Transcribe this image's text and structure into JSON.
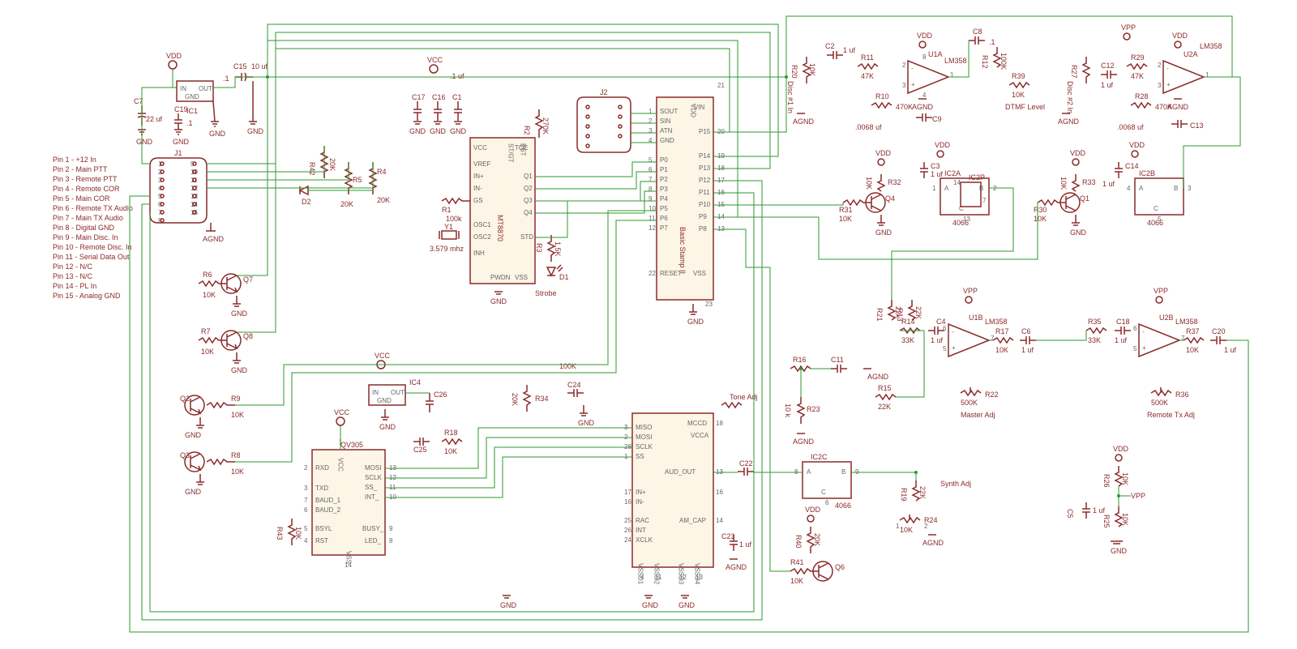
{
  "pinout": {
    "title": "",
    "pins": [
      "Pin 1 - +12 In",
      "Pin 2 - Main PTT",
      "Pin 3 - Remote PTT",
      "Pin 4 - Remote COR",
      "Pin 5 - Main COR",
      "Pin 6 - Remote TX Audio",
      "Pin 7 - Main TX Audio",
      "Pin 8 - Digital GND",
      "Pin 9 - Main Disc. In",
      "Pin 10 - Remote Disc. In",
      "Pin 11 - Serial Data Out",
      "Pin 12 - N/C",
      "Pin 13 - N/C",
      "Pin 14 - PL In",
      "Pin 15 - Analog GND"
    ]
  },
  "power": {
    "vdd": "VDD",
    "vcc": "VCC",
    "vpp": "VPP",
    "agnd": "AGND",
    "gnd": "GND"
  },
  "connectors": {
    "j1": "J1",
    "j2": "J2"
  },
  "ics": {
    "ic1": "IC1",
    "ic4": "IC4",
    "mt8870": "MT8870",
    "basic_stamp": "Basic Stamp II",
    "qv305": "QV305",
    "ic2a": "IC2A",
    "ic2b": "IC2B",
    "ic2c": "IC2C",
    "ic2p": "IC2P",
    "u1a": "U1A",
    "u1b": "U1B",
    "u2a": "U2A",
    "u2b": "U2B",
    "lm358": "LM358",
    "cd4066": "4066"
  },
  "transistors": {
    "q1": "Q1",
    "q2": "Q2",
    "q3": "Q3",
    "q4": "Q4",
    "q6": "Q6",
    "q7": "Q7",
    "q8": "Q8"
  },
  "diodes": {
    "d1": "D1",
    "d2": "D2"
  },
  "crystal": {
    "y1": "Y1",
    "freq": "3.579 mhz"
  },
  "resistors": {
    "r1": {
      "ref": "R1",
      "val": "100k"
    },
    "r2": {
      "ref": "R2",
      "val": "270K"
    },
    "r3": {
      "ref": "R3",
      "val": "1.5K"
    },
    "r4": {
      "ref": "R4",
      "val": "20K"
    },
    "r5": {
      "ref": "R5",
      "val": "20K"
    },
    "r6": {
      "ref": "R6",
      "val": "10K"
    },
    "r7": {
      "ref": "R7",
      "val": "10K"
    },
    "r8": {
      "ref": "R8",
      "val": "10K"
    },
    "r9": {
      "ref": "R9",
      "val": "10K"
    },
    "r10": {
      "ref": "R10",
      "val": "470K"
    },
    "r11": {
      "ref": "R11",
      "val": "47K"
    },
    "r12": {
      "ref": "R12",
      "val": "100K"
    },
    "r13": {
      "ref": "R13",
      "val": "22K"
    },
    "r14": {
      "ref": "R14",
      "val": "33K"
    },
    "r15": {
      "ref": "R15",
      "val": "22K"
    },
    "r16": {
      "ref": "R16",
      "val": ""
    },
    "r17": {
      "ref": "R17",
      "val": "10K"
    },
    "r18": {
      "ref": "R18",
      "val": "10K"
    },
    "r19": {
      "ref": "R19",
      "val": "22K"
    },
    "r20": {
      "ref": "R20",
      "val": "10K"
    },
    "r21": {
      "ref": "R21",
      "val": "22k"
    },
    "r22": {
      "ref": "R22",
      "val": "500K"
    },
    "r23": {
      "ref": "R23",
      "val": "10 k"
    },
    "r24": {
      "ref": "R24",
      "val": "10K"
    },
    "r25": {
      "ref": "R25",
      "val": "10K"
    },
    "r26": {
      "ref": "R26",
      "val": "10K"
    },
    "r27": {
      "ref": "R27",
      "val": ""
    },
    "r28": {
      "ref": "R28",
      "val": "470K"
    },
    "r29": {
      "ref": "R29",
      "val": "47K"
    },
    "r30": {
      "ref": "R30",
      "val": "10K"
    },
    "r31": {
      "ref": "R31",
      "val": "10K"
    },
    "r32": {
      "ref": "R32",
      "val": "10K"
    },
    "r33": {
      "ref": "R33",
      "val": "10K"
    },
    "r34": {
      "ref": "R34",
      "val": "20K"
    },
    "r35": {
      "ref": "R35",
      "val": "33K"
    },
    "r36": {
      "ref": "R36",
      "val": "500K"
    },
    "r37": {
      "ref": "R37",
      "val": "10K"
    },
    "r39": {
      "ref": "R39",
      "val": "10K"
    },
    "r40": {
      "ref": "R40",
      "val": "20K"
    },
    "r41": {
      "ref": "R41",
      "val": "10K"
    },
    "r42": {
      "ref": "R42",
      "val": "20K"
    },
    "r43": {
      "ref": "R43",
      "val": "10K"
    }
  },
  "caps": {
    "c1": {
      "ref": "C1",
      "val": ".1 uf"
    },
    "c2": {
      "ref": "C2",
      "val": "1 uf"
    },
    "c3": {
      "ref": "C3",
      "val": "1 uf"
    },
    "c4": {
      "ref": "C4",
      "val": "1 uf"
    },
    "c5": {
      "ref": "C5",
      "val": "1 uf"
    },
    "c6": {
      "ref": "C6",
      "val": "1 uf"
    },
    "c7": {
      "ref": "C7",
      "val": "22 uf"
    },
    "c8": {
      "ref": "C8",
      "val": ".1"
    },
    "c9": {
      "ref": "C9",
      "val": ".0068 uf"
    },
    "c11": {
      "ref": "C11",
      "val": ""
    },
    "c12": {
      "ref": "C12",
      "val": "1 uf"
    },
    "c13": {
      "ref": "C13",
      "val": ".0068 uf"
    },
    "c14": {
      "ref": "C14",
      "val": "1 uf"
    },
    "c15": {
      "ref": "C15",
      "val": "10 uf"
    },
    "c16": {
      "ref": "C16",
      "val": ""
    },
    "c17": {
      "ref": "C17",
      "val": ""
    },
    "c18": {
      "ref": "C18",
      "val": "1 uf"
    },
    "c19": {
      "ref": "C19",
      "val": ".1"
    },
    "c20": {
      "ref": "C20",
      "val": "1 uf"
    },
    "c22": {
      "ref": "C22",
      "val": ""
    },
    "c23": {
      "ref": "C23",
      "val": "1 uf"
    },
    "c24": {
      "ref": "C24",
      "val": ""
    },
    "c25": {
      "ref": "C25",
      "val": ""
    },
    "c26": {
      "ref": "C26",
      "val": ""
    }
  },
  "labels": {
    "strobe": "Strobe",
    "dtmf": "DTMF Level",
    "disc1": "Disc #1 In",
    "disc2": "Disc #2 In",
    "tone_adj": "Tone Adj",
    "master_adj": "Master Adj",
    "remote_tx_adj": "Remote Tx Adj",
    "synth_adj": "Synth Adj",
    "100k": "100K",
    "val_pt1": ".1"
  },
  "mt8870_pins": {
    "vcc": "VCC",
    "vref": "VREF",
    "inp": "IN+",
    "inn": "IN-",
    "gs": "GS",
    "osc1": "OSC1",
    "osc2": "OSC2",
    "inh": "INH",
    "pwdn": "PWDN",
    "vss": "VSS",
    "toe": "TOE",
    "stgt": "ST/GT",
    "est": "EST",
    "q1": "Q1",
    "q2": "Q2",
    "q3": "Q3",
    "q4": "Q4",
    "std": "STD"
  },
  "stamp_pins": {
    "vin": "VIN",
    "sout": "SOUT",
    "sin": "SIN",
    "atn": "ATN",
    "gnd": "GND",
    "p0": "P0",
    "p1": "P1",
    "p2": "P2",
    "p3": "P3",
    "p4": "P4",
    "p5": "P5",
    "p6": "P6",
    "p7": "P7",
    "p8": "P8",
    "p9": "P9",
    "p10": "P10",
    "p11": "P11",
    "p12": "P12",
    "p13": "P13",
    "p14": "P14",
    "p15": "P15",
    "reset": "RESET",
    "vss": "VSS",
    "vdd": "VDD"
  },
  "qv305_pins": {
    "rxd": "RXD",
    "txd": "TXD",
    "baud1": "BAUD_1",
    "baud2": "BAUD_2",
    "bsyl": "BSYL",
    "rst": "RST",
    "mosi": "MOSI",
    "sclk": "SCLK",
    "ss": "SS_",
    "int": "INT_",
    "busy": "BUSY_",
    "led": "LED_",
    "vcc": "VCC",
    "vss": "VSS"
  },
  "audio_ic_pins": {
    "miso": "MISO",
    "mosi": "MOSI",
    "sclk": "SCLK",
    "ss": "SS",
    "aud_out": "AUD_OUT",
    "inp": "IN+",
    "inn": "IN-",
    "rac": "RAC",
    "int": "INT",
    "xclk": "XCLK",
    "mccd": "MCCD",
    "vcca": "VCCA",
    "am_cap": "AM_CAP",
    "vssd1": "VSSD1",
    "vssd2": "VSSD2",
    "vssd3": "VSSD3",
    "vssd4": "VSSD4"
  },
  "reg_pins": {
    "in": "IN",
    "out": "OUT",
    "gnd": "GND"
  },
  "switch_pins": {
    "a": "A",
    "b": "B",
    "c": "C"
  }
}
